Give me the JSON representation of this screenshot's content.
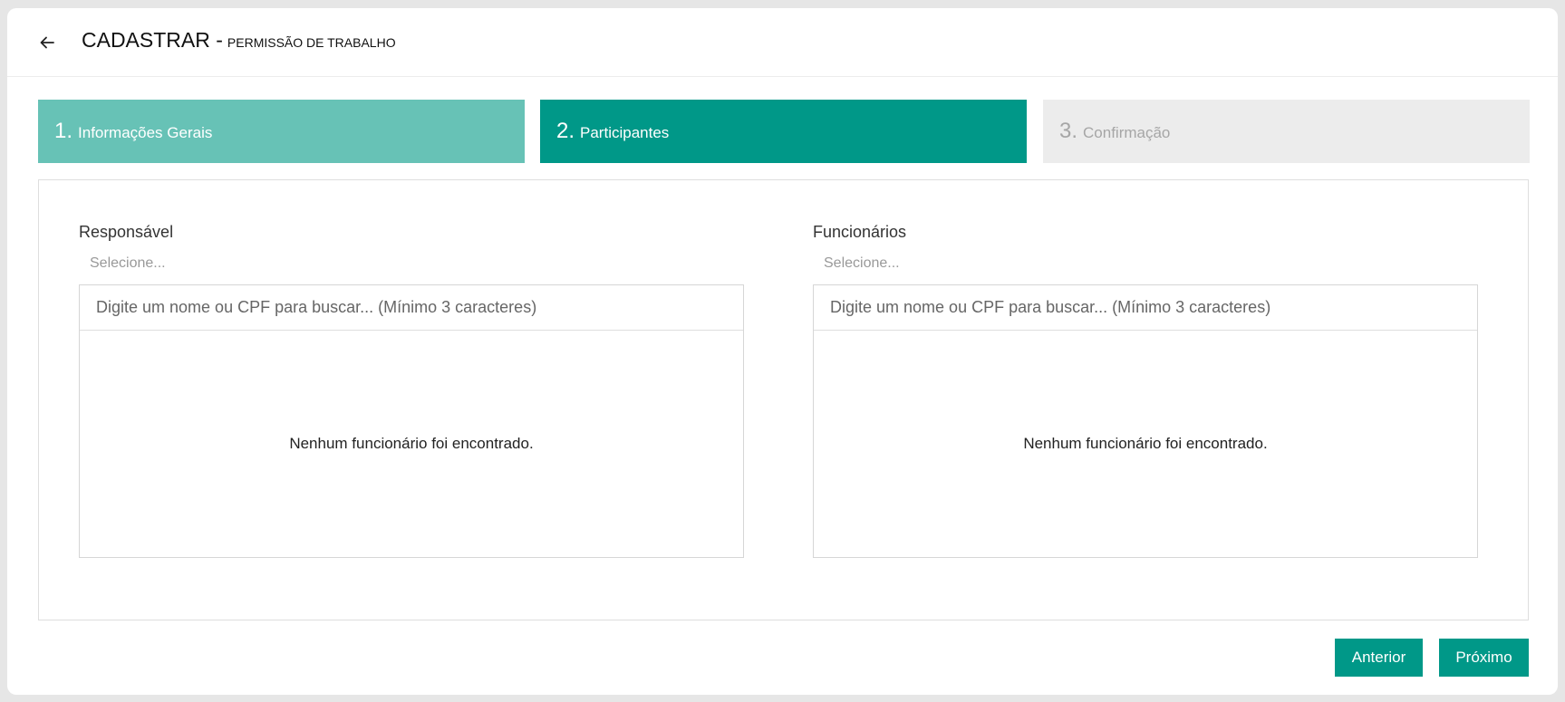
{
  "header": {
    "title": "CADASTRAR -",
    "subtitle": "PERMISSÃO DE TRABALHO",
    "back_icon": "arrow-left-icon"
  },
  "steps": [
    {
      "number": "1.",
      "label": "Informações Gerais",
      "state": "done",
      "color": "#67c2b6"
    },
    {
      "number": "2.",
      "label": "Participantes",
      "state": "active",
      "color": "#009888"
    },
    {
      "number": "3.",
      "label": "Confirmação",
      "state": "pending",
      "color": "#ececec"
    }
  ],
  "responsavel": {
    "label": "Responsável",
    "hint": "Selecione...",
    "search_placeholder": "Digite um nome ou CPF para buscar... (Mínimo 3 caracteres)",
    "search_value": "",
    "empty_message": "Nenhum funcionário foi encontrado."
  },
  "funcionarios": {
    "label": "Funcionários",
    "hint": "Selecione...",
    "search_placeholder": "Digite um nome ou CPF para buscar... (Mínimo 3 caracteres)",
    "search_value": "",
    "empty_message": "Nenhum funcionário foi encontrado."
  },
  "actions": {
    "previous_label": "Anterior",
    "next_label": "Próximo"
  },
  "colors": {
    "accent": "#009888",
    "accent_light": "#67c2b6",
    "inactive": "#ececec"
  }
}
